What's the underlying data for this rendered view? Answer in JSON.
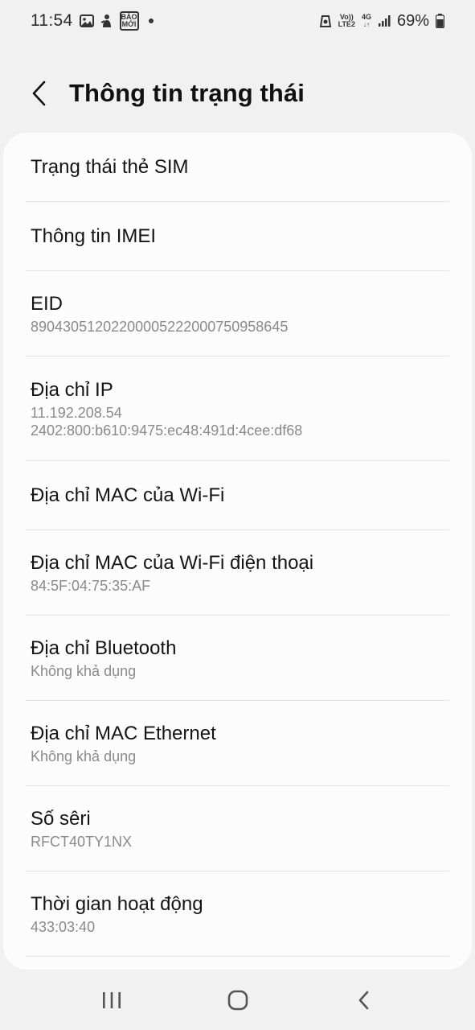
{
  "status_bar": {
    "time": "11:54",
    "left_icons": [
      "gallery-icon",
      "figure-icon",
      "baomoi-icon"
    ],
    "baomoi_label_top": "BÁO",
    "baomoi_label_bottom": "MỚI",
    "volte_top": "Vo))",
    "volte_bottom": "LTE2",
    "network": "4G",
    "battery": "69%"
  },
  "header": {
    "title": "Thông tin trạng thái"
  },
  "items": [
    {
      "title": "Trạng thái thẻ SIM"
    },
    {
      "title": "Thông tin IMEI"
    },
    {
      "title": "EID",
      "sub": "89043051202200005222000750958645"
    },
    {
      "title": "Địa chỉ IP",
      "sub": "11.192.208.54",
      "sub2": "2402:800:b610:9475:ec48:491d:4cee:df68"
    },
    {
      "title": "Địa chỉ MAC của Wi-Fi"
    },
    {
      "title": "Địa chỉ MAC của Wi-Fi điện thoại",
      "sub": "84:5F:04:75:35:AF"
    },
    {
      "title": "Địa chỉ Bluetooth",
      "sub": "Không khả dụng"
    },
    {
      "title": "Địa chỉ MAC Ethernet",
      "sub": "Không khả dụng"
    },
    {
      "title": "Số sêri",
      "sub": "RFCT40TY1NX"
    },
    {
      "title": "Thời gian hoạt động",
      "sub": "433:03:40"
    }
  ],
  "nav": {
    "recents": "recents-icon",
    "home": "home-icon",
    "back": "back-icon"
  },
  "colors": {
    "background": "#f1f1f1",
    "card": "#fcfcfc",
    "subtitle": "#8a8a8a"
  }
}
